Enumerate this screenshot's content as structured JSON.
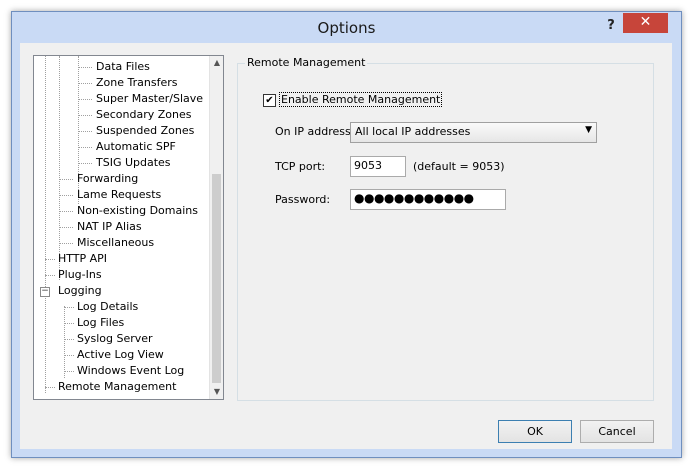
{
  "window": {
    "title": "Options",
    "help_label": "?",
    "close_label": "✕"
  },
  "tree": {
    "items": [
      {
        "label": "Data Files"
      },
      {
        "label": "Zone Transfers"
      },
      {
        "label": "Super Master/Slave"
      },
      {
        "label": "Secondary Zones"
      },
      {
        "label": "Suspended Zones"
      },
      {
        "label": "Automatic SPF"
      },
      {
        "label": "TSIG Updates"
      },
      {
        "label": "Forwarding"
      },
      {
        "label": "Lame Requests"
      },
      {
        "label": "Non-existing Domains"
      },
      {
        "label": "NAT IP Alias"
      },
      {
        "label": "Miscellaneous"
      },
      {
        "label": "HTTP API"
      },
      {
        "label": "Plug-Ins"
      },
      {
        "label": "Logging",
        "expander": "−"
      },
      {
        "label": "Log Details"
      },
      {
        "label": "Log Files"
      },
      {
        "label": "Syslog Server"
      },
      {
        "label": "Active Log View"
      },
      {
        "label": "Windows Event Log"
      },
      {
        "label": "Remote Management"
      }
    ],
    "scroll_up": "▲",
    "scroll_down": "▼"
  },
  "panel": {
    "group_title": "Remote Management",
    "enable_checkbox": {
      "label": "Enable Remote Management",
      "checked": true,
      "check_glyph": "✔"
    },
    "ip_address": {
      "label": "On IP address:",
      "value": "All local IP addresses",
      "arrow": "▼"
    },
    "tcp_port": {
      "label": "TCP port:",
      "value": "9053",
      "hint": "(default = 9053)"
    },
    "password": {
      "label": "Password:",
      "value": "●●●●●●●●●●●●"
    }
  },
  "buttons": {
    "ok": "OK",
    "cancel": "Cancel"
  }
}
